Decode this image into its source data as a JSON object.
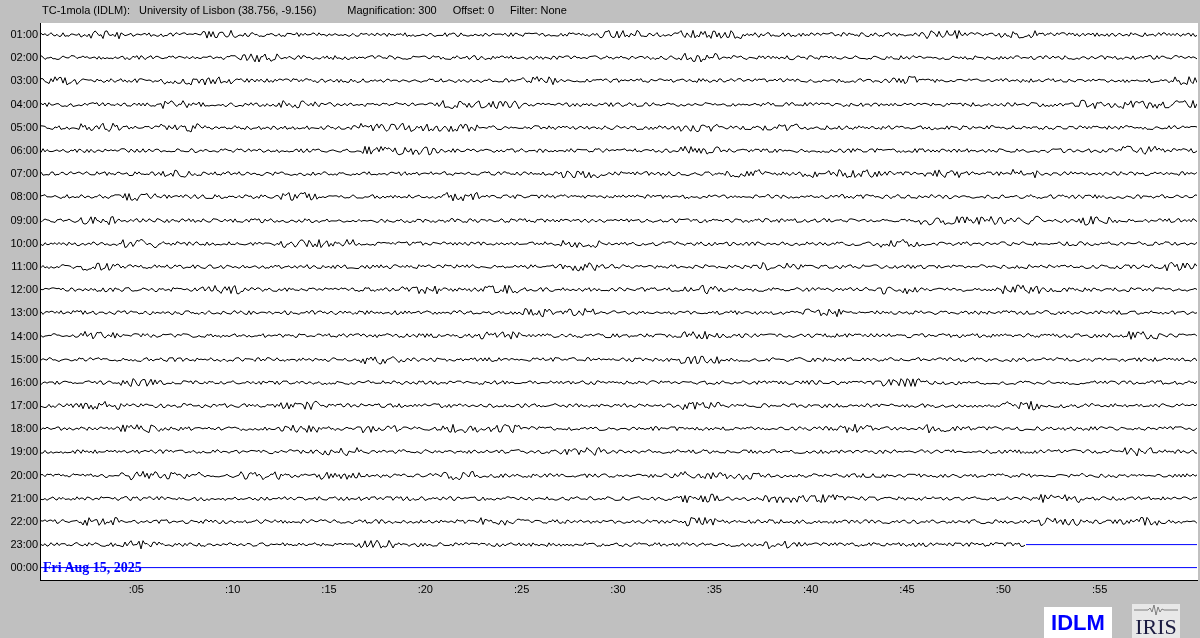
{
  "header": {
    "station": "TC-1mola (IDLM):",
    "location": "University of Lisbon (38.756, -9.156)",
    "magnification": "Magnification: 300",
    "offset": "Offset: 0",
    "filter": "Filter: None"
  },
  "rows": [
    {
      "label": "01:00",
      "kind": "trace"
    },
    {
      "label": "02:00",
      "kind": "trace"
    },
    {
      "label": "03:00",
      "kind": "trace"
    },
    {
      "label": "04:00",
      "kind": "trace"
    },
    {
      "label": "05:00",
      "kind": "trace"
    },
    {
      "label": "06:00",
      "kind": "trace"
    },
    {
      "label": "07:00",
      "kind": "trace"
    },
    {
      "label": "08:00",
      "kind": "trace"
    },
    {
      "label": "09:00",
      "kind": "trace"
    },
    {
      "label": "10:00",
      "kind": "trace"
    },
    {
      "label": "11:00",
      "kind": "trace"
    },
    {
      "label": "12:00",
      "kind": "trace"
    },
    {
      "label": "13:00",
      "kind": "trace"
    },
    {
      "label": "14:00",
      "kind": "trace"
    },
    {
      "label": "15:00",
      "kind": "trace"
    },
    {
      "label": "16:00",
      "kind": "trace"
    },
    {
      "label": "17:00",
      "kind": "trace"
    },
    {
      "label": "18:00",
      "kind": "trace"
    },
    {
      "label": "19:00",
      "kind": "trace"
    },
    {
      "label": "20:00",
      "kind": "trace"
    },
    {
      "label": "21:00",
      "kind": "trace"
    },
    {
      "label": "22:00",
      "kind": "trace"
    },
    {
      "label": "23:00",
      "kind": "partial"
    },
    {
      "label": "00:00",
      "kind": "pending"
    }
  ],
  "date": "Fri Aug 15, 2025",
  "x_ticks": [
    ":05",
    ":10",
    ":15",
    ":20",
    ":25",
    ":30",
    ":35",
    ":40",
    ":45",
    ":50",
    ":55"
  ],
  "logos": {
    "station": "IDLM",
    "network": "IRIS"
  }
}
